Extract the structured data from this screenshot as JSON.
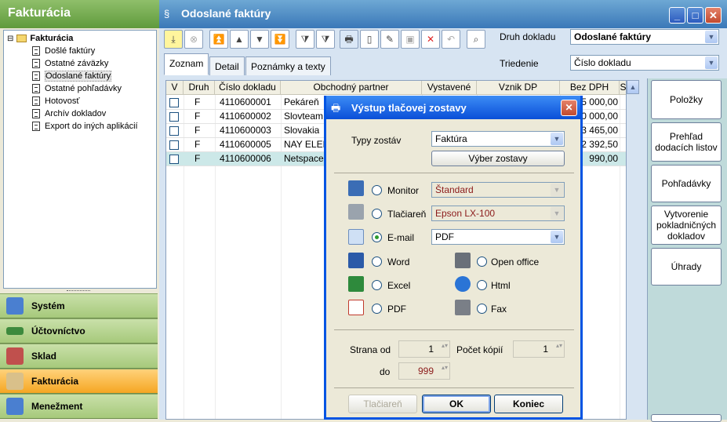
{
  "left": {
    "title": "Fakturácia",
    "tree": {
      "root": "Fakturácia",
      "items": [
        "Došlé faktúry",
        "Ostatné záväzky",
        "Odoslané faktúry",
        "Ostatné pohľadávky",
        "Hotovosť",
        "Archív dokladov",
        "Export do iných aplikácií"
      ]
    },
    "modules": [
      "Systém",
      "Účtovníctvo",
      "Sklad",
      "Fakturácia",
      "Menežment"
    ]
  },
  "window": {
    "title": "Odoslané faktúry",
    "tabs": [
      "Zoznam",
      "Detail",
      "Poznámky a texty"
    ],
    "druh_label": "Druh dokladu",
    "druh_value": "Odoslané faktúry",
    "triedenie_label": "Triedenie",
    "triedenie_value": "Číslo dokladu"
  },
  "grid": {
    "columns": [
      "V",
      "Druh",
      "Číslo dokladu",
      "Obchodný partner",
      "Vystavené",
      "Vznik DP",
      "Bez DPH",
      "S"
    ],
    "rows": [
      {
        "druh": "F",
        "cislo": "4110600001",
        "partner": "Pekáreň",
        "bez_dph": "5 000,00"
      },
      {
        "druh": "F",
        "cislo": "4110600002",
        "partner": "Slovteam",
        "bez_dph": "0 000,00"
      },
      {
        "druh": "F",
        "cislo": "4110600003",
        "partner": "Slovakia",
        "bez_dph": "3 465,00"
      },
      {
        "druh": "F",
        "cislo": "4110600005",
        "partner": "NAY ELEK",
        "bez_dph": "2 392,50"
      },
      {
        "druh": "F",
        "cislo": "4110600006",
        "partner": "Netspace",
        "bez_dph": "990,00"
      }
    ]
  },
  "side_buttons": [
    "Položky",
    "Prehľad dodacích listov",
    "Pohľadávky",
    "Vytvorenie pokladničných dokladov",
    "Úhrady"
  ],
  "dialog": {
    "title": "Výstup tlačovej zostavy",
    "typy_label": "Typy zostáv",
    "typy_value": "Faktúra",
    "vyber_button": "Výber zostavy",
    "monitor_label": "Monitor",
    "monitor_value": "Štandard",
    "tlaciaren_label": "Tlačiareň",
    "tlaciaren_value": "Epson LX-100",
    "email_label": "E-mail",
    "email_value": "PDF",
    "word_label": "Word",
    "openoffice_label": "Open office",
    "excel_label": "Excel",
    "html_label": "Html",
    "pdf_label": "PDF",
    "fax_label": "Fax",
    "strana_od_label": "Strana od",
    "strana_od_value": "1",
    "do_label": "do",
    "do_value": "999",
    "kopii_label": "Počet kópií",
    "kopii_value": "1",
    "btn_tlaciaren": "Tlačiareň",
    "btn_ok": "OK",
    "btn_koniec": "Koniec"
  },
  "colors": {
    "accent": "#0054e3",
    "active_module": "#f5a623",
    "selected_row": "#cce8e8"
  }
}
